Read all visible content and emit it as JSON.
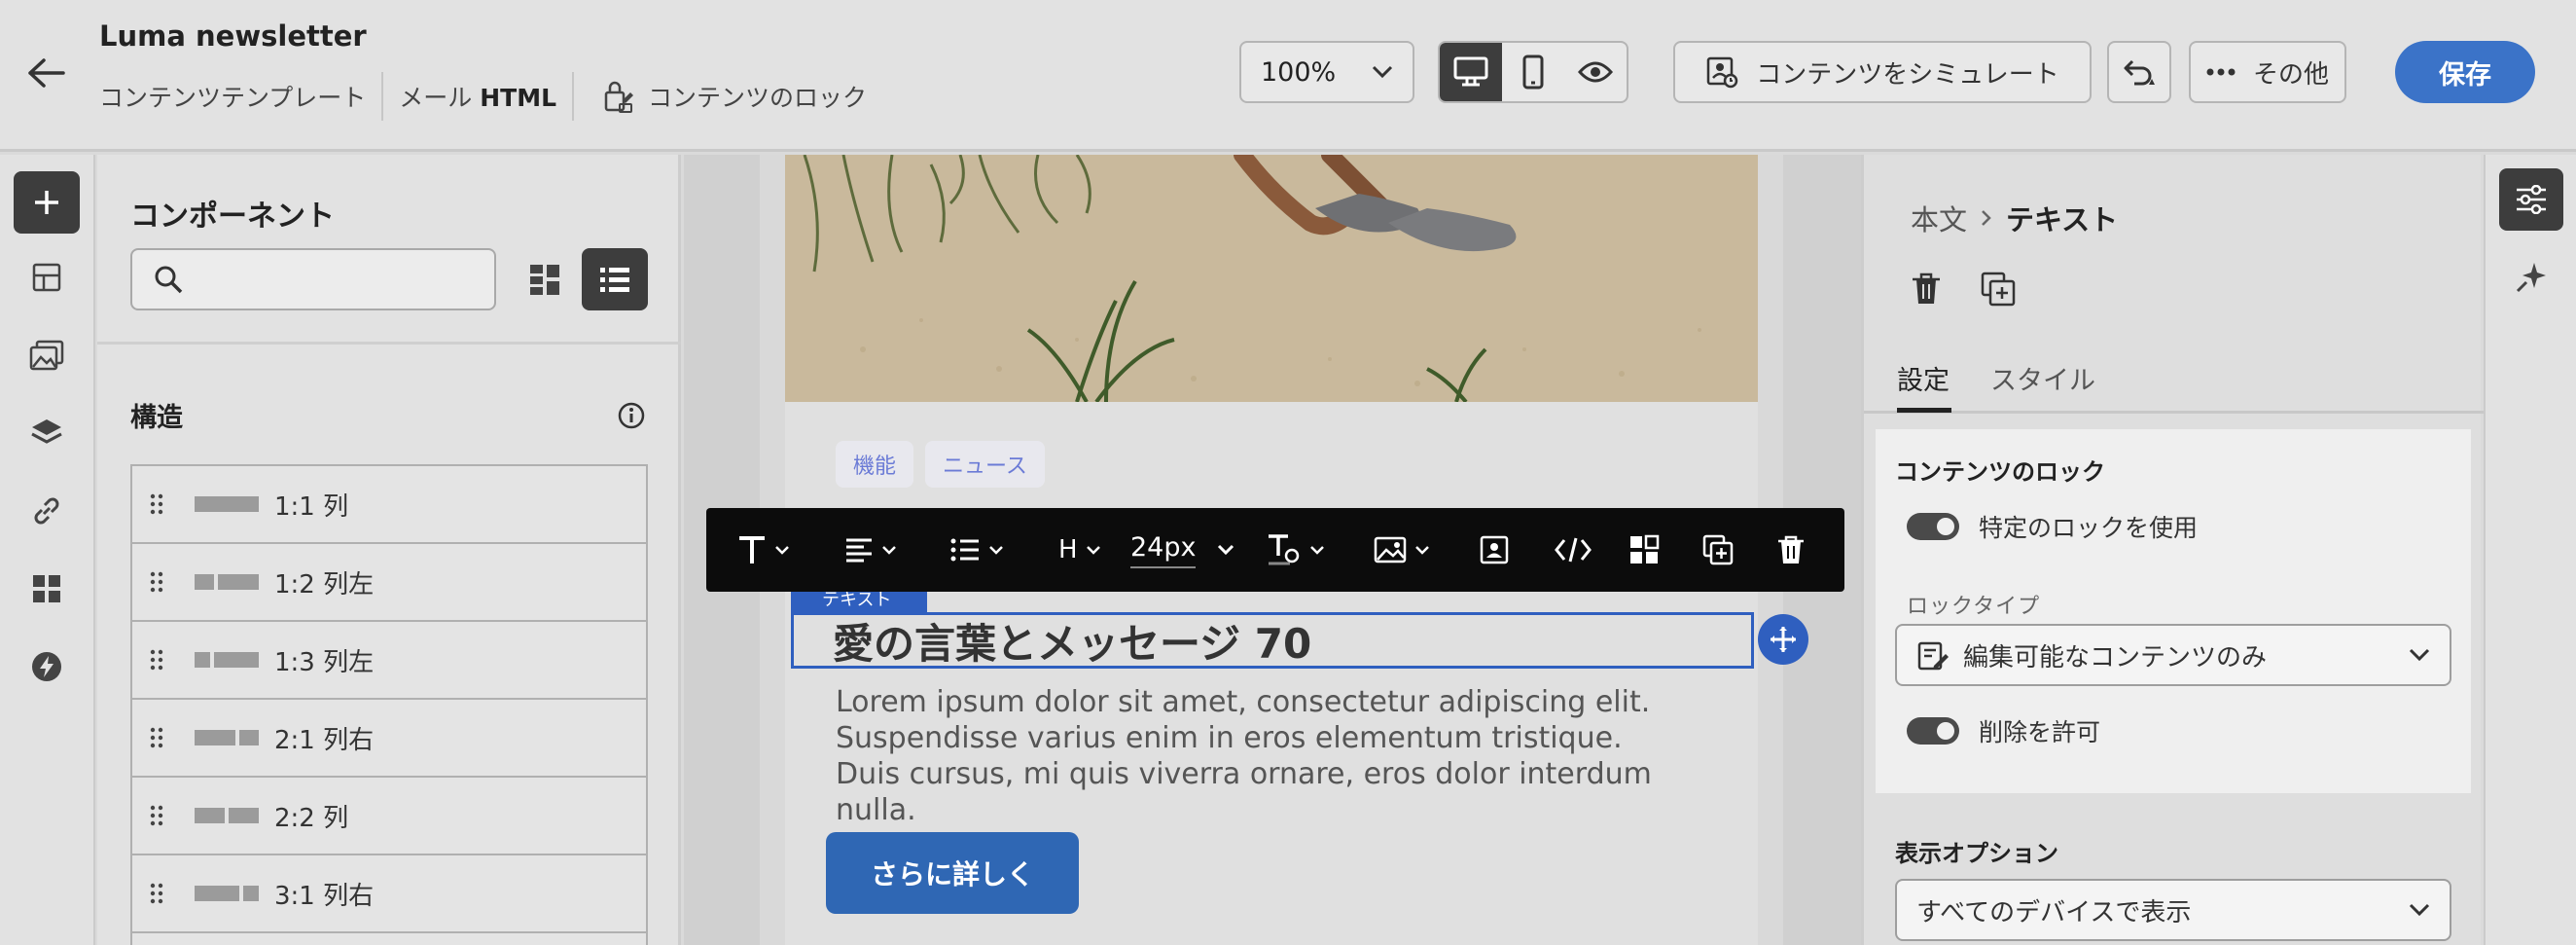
{
  "header": {
    "title": "Luma newsletter",
    "template_label": "コンテンツテンプレート",
    "format_prefix": "メール",
    "format_value": "HTML",
    "content_lock": "コンテンツのロック",
    "zoom": "100%",
    "simulate_label": "コンテンツをシミュレート",
    "more_label": "その他",
    "save_label": "保存"
  },
  "components": {
    "title": "コンポーネント",
    "search_placeholder": "",
    "structure_title": "構造",
    "items": [
      {
        "label": "1:1 列"
      },
      {
        "label": "1:2 列左"
      },
      {
        "label": "1:3 列左"
      },
      {
        "label": "2:1 列右"
      },
      {
        "label": "2:2 列"
      },
      {
        "label": "3:1 列右"
      }
    ]
  },
  "canvas": {
    "tags": [
      "機能",
      "ニュース"
    ],
    "selected_badge": "テキスト",
    "heading": "愛の言葉とメッセージ 70",
    "body": "Lorem ipsum dolor sit amet, consectetur adipiscing elit. Suspendisse varius enim in eros elementum tristique. Duis cursus, mi quis viverra ornare, eros dolor interdum nulla.",
    "cta": "さらに詳しく",
    "toolbar": {
      "heading_tag": "H",
      "font_size": "24px"
    }
  },
  "properties": {
    "crumb_parent": "本文",
    "crumb_current": "テキスト",
    "tab_settings": "設定",
    "tab_style": "スタイル",
    "lock_section": "コンテンツのロック",
    "specific_lock": "特定のロックを使用",
    "lock_type_label": "ロックタイプ",
    "lock_type_value": "編集可能なコンテンツのみ",
    "allow_delete": "削除を許可",
    "display_section": "表示オプション",
    "display_value": "すべてのデバイスで表示"
  },
  "colors": {
    "accent": "#3b73c8",
    "toolbar_bg": "#0c0c0c",
    "selection": "#2f5fbf"
  }
}
